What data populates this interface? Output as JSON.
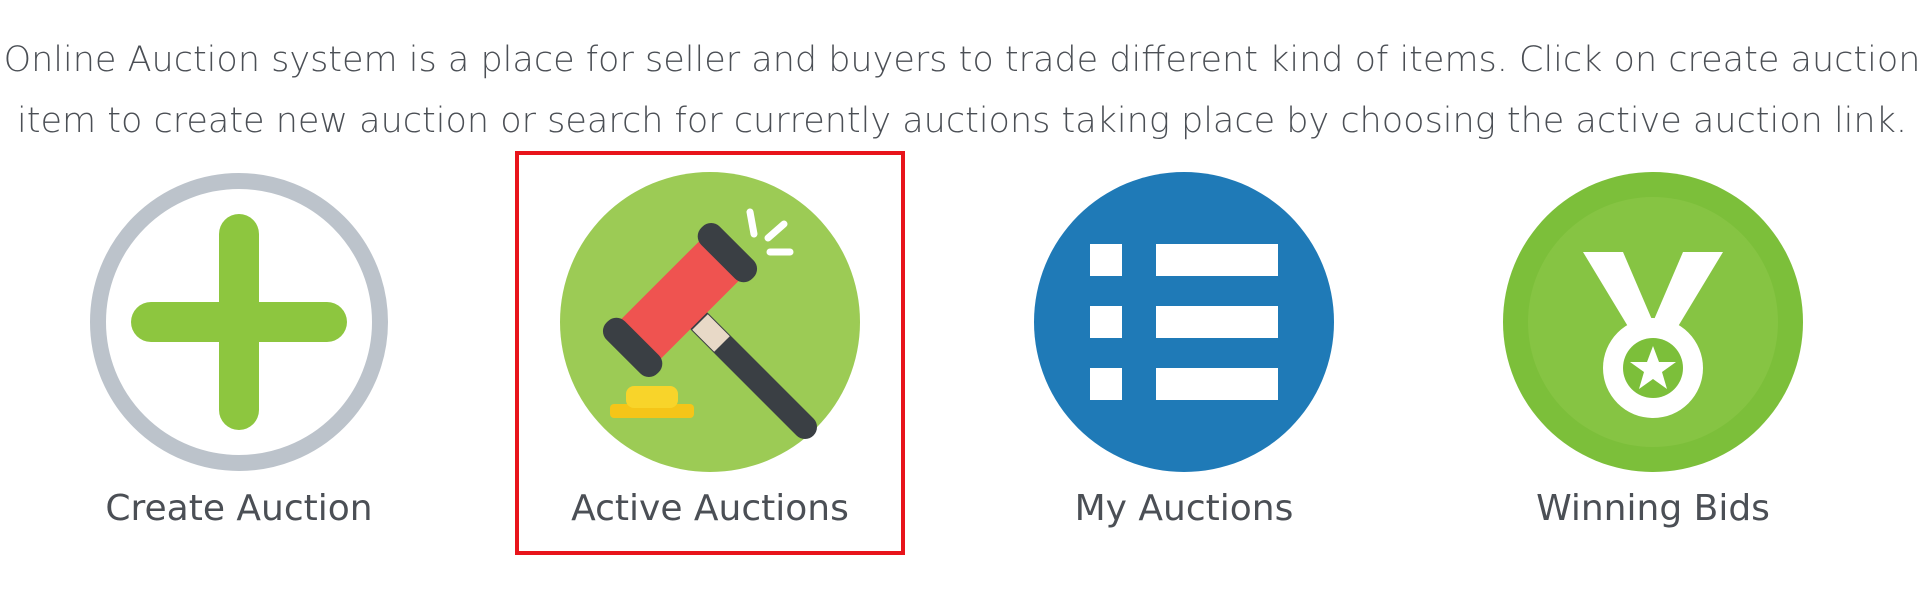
{
  "intro": {
    "line1": "Online Auction system is a place for seller and buyers to trade different kind of items. Click on create auction",
    "line2": "item to create new auction or search for currently auctions taking place by choosing the active auction link."
  },
  "tiles": [
    {
      "label": "Create Auction",
      "icon": "plus-circle-icon"
    },
    {
      "label": "Active Auctions",
      "icon": "gavel-icon"
    },
    {
      "label": "My Auctions",
      "icon": "list-icon"
    },
    {
      "label": "Winning Bids",
      "icon": "medal-icon"
    }
  ],
  "colors": {
    "highlight": "#e8141b",
    "green": "#8dc63f",
    "blue": "#1f7ab7",
    "gray_ring": "#bcc3cb",
    "gavel_red": "#ef5350"
  }
}
